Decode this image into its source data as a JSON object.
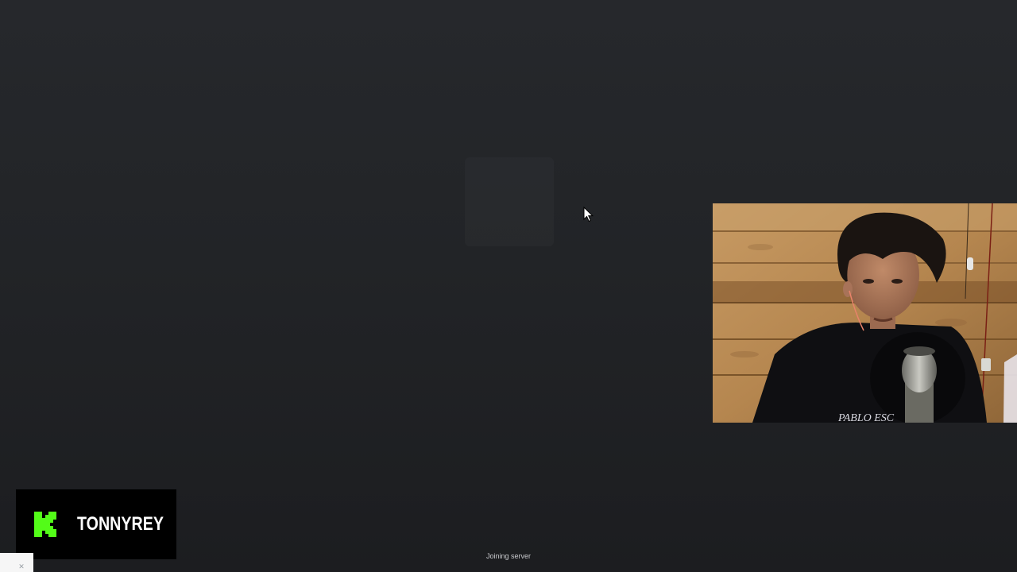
{
  "status": {
    "text": "Joining server"
  },
  "branding": {
    "name": "TONNYREY",
    "logo_icon": "kick-logo-icon",
    "logo_color": "#53fc18"
  },
  "webcam": {
    "shirt_text": "PABLO ESC"
  },
  "corner_widget": {
    "icon": "close-icon",
    "glyph": "✕"
  },
  "colors": {
    "background": "#222427",
    "accent": "#53fc18"
  }
}
